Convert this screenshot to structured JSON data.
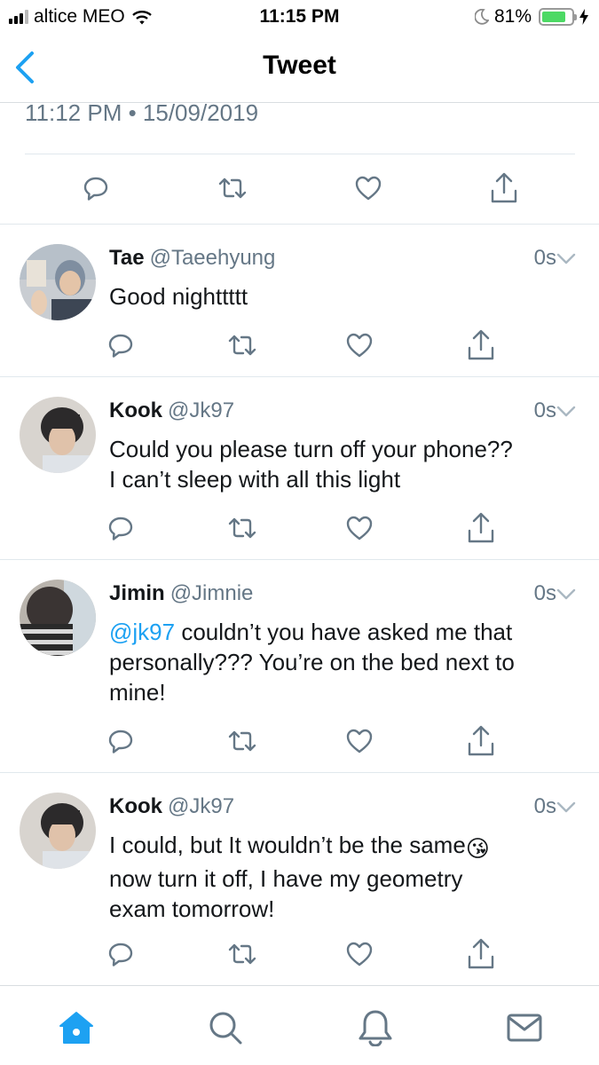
{
  "status_bar": {
    "carrier": "altice MEO",
    "time": "11:15 PM",
    "battery": "81%",
    "battery_level": 0.81,
    "icons": [
      "signal-icon",
      "wifi-icon",
      "moon-icon",
      "battery-icon",
      "charging-icon"
    ]
  },
  "nav": {
    "title": "Tweet",
    "back_icon": "chevron-left-icon"
  },
  "focused_tweet": {
    "datetime": "11:12 PM • 15/09/2019"
  },
  "action_icons": [
    "reply-icon",
    "retweet-icon",
    "like-icon",
    "share-icon"
  ],
  "replies": [
    {
      "name": "Tae",
      "handle": "@Taeehyung",
      "time": "0s",
      "text": "Good nighttttt"
    },
    {
      "name": "Kook",
      "handle": "@Jk97",
      "time": "0s",
      "text_line1": "Could you please turn off your phone??",
      "text_line2": "I can’t sleep with all this light"
    },
    {
      "name": "Jimin",
      "handle": "@Jimnie",
      "time": "0s",
      "mention": "@jk97",
      "text_line1": " couldn’t you have asked me that",
      "text_line2": "personally??? You’re on the bed next to",
      "text_line3": "mine!"
    },
    {
      "name": "Kook",
      "handle": "@Jk97",
      "time": "0s",
      "text_line1": "I could, but It wouldn’t be the same",
      "emoji": "😘",
      "text_line2": "now turn it off, I have my geometry",
      "text_line3": "exam tomorrow!"
    }
  ],
  "tab_bar": {
    "tabs": [
      "home-icon",
      "search-icon",
      "notifications-icon",
      "messages-icon"
    ],
    "active": "home-icon",
    "accent": "#1da1f2"
  },
  "colors": {
    "accent": "#1da1f2",
    "muted": "#657786",
    "icon_gray": "#657786",
    "battery_green": "#4cd964"
  }
}
